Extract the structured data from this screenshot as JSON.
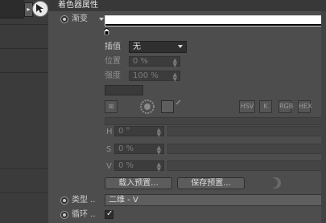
{
  "panel": {
    "title": "着色器属性"
  },
  "gradient": {
    "label": "渐变"
  },
  "interpolation": {
    "label": "插值",
    "value": "无"
  },
  "position": {
    "label": "位置",
    "value": "0 %"
  },
  "intensity": {
    "label": "强度",
    "value": "100 %"
  },
  "color_mode_buttons": [
    "HSV",
    "K",
    "RGB",
    "HEX"
  ],
  "hsv": {
    "h": {
      "label": "H",
      "value": "0 °"
    },
    "s": {
      "label": "S",
      "value": "0 %"
    },
    "v": {
      "label": "V",
      "value": "0 %"
    }
  },
  "buttons": {
    "load_preset": "载入预置...",
    "save_preset": "保存预置..."
  },
  "type": {
    "label": "类型 ..",
    "value": "二维 - V"
  },
  "cycle": {
    "label": "循环 .."
  }
}
